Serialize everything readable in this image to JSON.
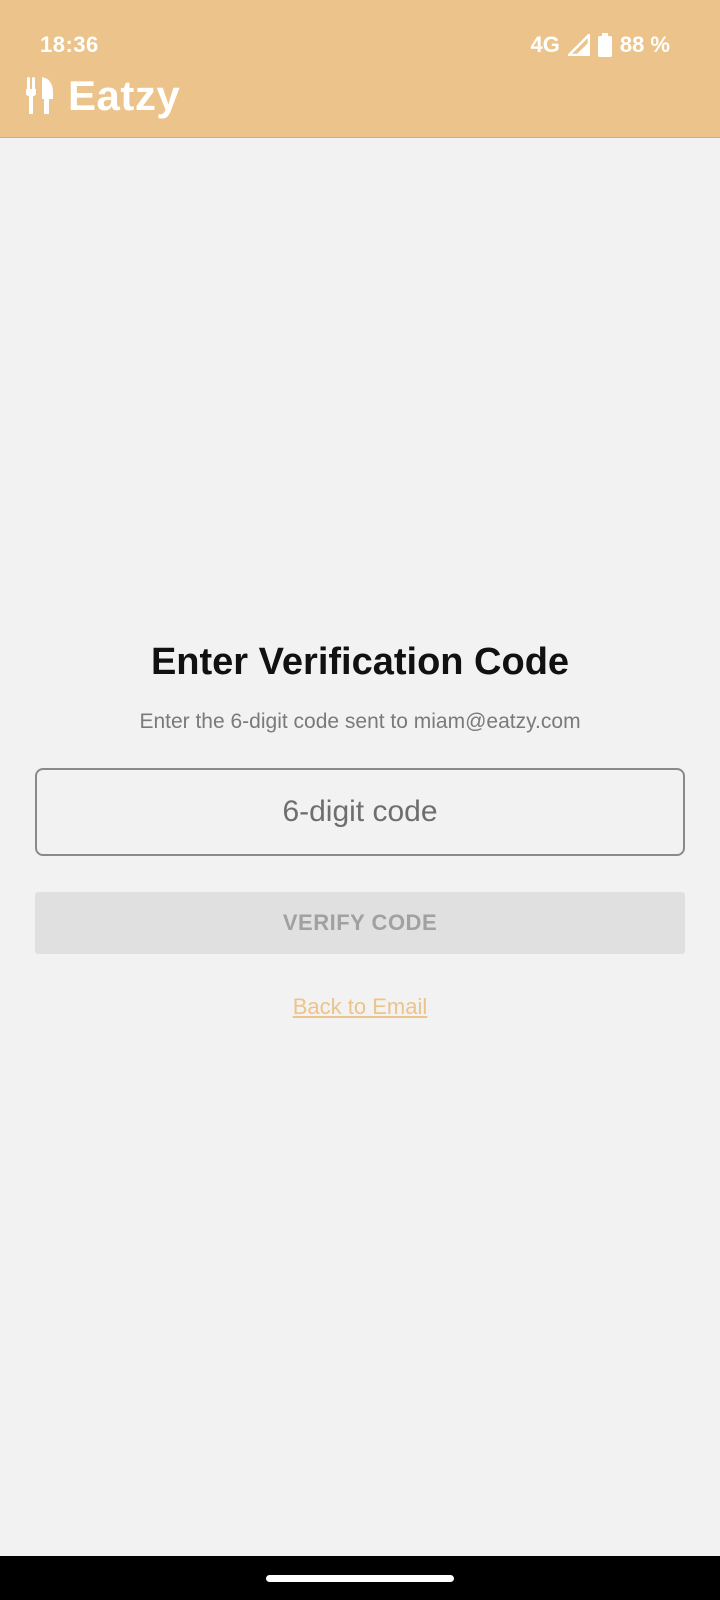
{
  "status_bar": {
    "time": "18:36",
    "network": "4G",
    "battery": "88 %"
  },
  "app_bar": {
    "title": "Eatzy",
    "logo_icon": "fork-knife-icon"
  },
  "verification": {
    "heading": "Enter Verification Code",
    "subtext": "Enter the 6-digit code sent to miam@eatzy.com",
    "code_placeholder": "6-digit code",
    "code_value": "",
    "verify_label": "VERIFY CODE",
    "back_label": "Back to Email"
  },
  "colors": {
    "brand": "#ecc48b",
    "background": "#f2f2f2",
    "button_disabled_bg": "#e0e0e0",
    "button_disabled_text": "#a1a1a1"
  }
}
